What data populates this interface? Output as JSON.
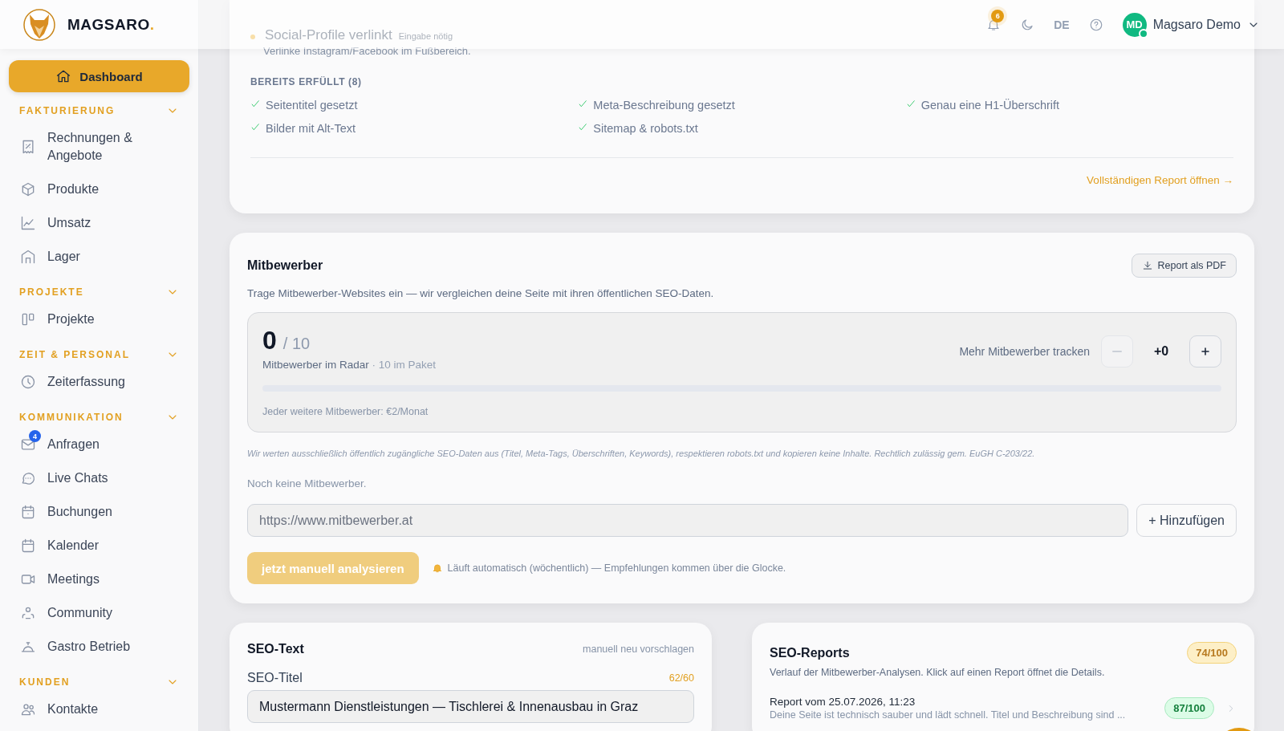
{
  "brand": {
    "name": "MAGSARO",
    "dot": "."
  },
  "header": {
    "notifications": "6",
    "language": "DE",
    "avatar": "MD",
    "user": "Magsaro Demo",
    "online": true
  },
  "sidebar": {
    "dashboard": {
      "label": "Dashboard",
      "selected": true
    },
    "sections": [
      {
        "title": "FAKTURIERUNG",
        "expanded": true,
        "items": [
          {
            "label": "Rechnungen & Angebote"
          },
          {
            "label": "Produkte"
          },
          {
            "label": "Umsatz"
          },
          {
            "label": "Lager"
          }
        ]
      },
      {
        "title": "PROJEKTE",
        "expanded": true,
        "items": [
          {
            "label": "Projekte"
          }
        ]
      },
      {
        "title": "ZEIT & PERSONAL",
        "expanded": true,
        "items": [
          {
            "label": "Zeiterfassung"
          }
        ]
      },
      {
        "title": "KOMMUNIKATION",
        "expanded": true,
        "items": [
          {
            "label": "Anfragen",
            "badge": "4"
          },
          {
            "label": "Live Chats"
          },
          {
            "label": "Buchungen"
          },
          {
            "label": "Kalender"
          },
          {
            "label": "Meetings"
          },
          {
            "label": "Community"
          },
          {
            "label": "Gastro Betrieb"
          }
        ]
      },
      {
        "title": "KUNDEN",
        "expanded": true,
        "items": [
          {
            "label": "Kontakte"
          }
        ]
      }
    ]
  },
  "checklist": {
    "pending": {
      "title": "Social-Profile verlinkt",
      "tag": "Eingabe nötig",
      "hint": "Verlinke Instagram/Facebook im Fußbereich."
    },
    "done_heading": "BEREITS ERFÜLLT (8)",
    "done": [
      "Seitentitel gesetzt",
      "Meta-Beschreibung gesetzt",
      "Genau eine H1-Überschrift",
      "Bilder mit Alt-Text",
      "Sitemap & robots.txt"
    ],
    "link": "Vollständigen Report öffnen →"
  },
  "competitors": {
    "title": "Mitbewerber",
    "pdf_button": "Report als PDF",
    "description": "Trage Mitbewerber-Websites ein — wir vergleichen deine Seite mit ihren öffentlichen SEO-Daten.",
    "count": "0",
    "total": "/ 10",
    "count_label": "Mitbewerber im Radar",
    "package": "· 10 im Paket",
    "level": 0,
    "stepper_label": "Mehr Mitbewerber tracken",
    "minus_disabled": true,
    "extra": "+0",
    "price_note": "Jeder weitere Mitbewerber: €2/Monat",
    "legal": "Wir werten ausschließlich öffentlich zugängliche SEO-Daten aus (Titel, Meta-Tags, Überschriften, Keywords), respektieren robots.txt und kopieren keine Inhalte. Rechtlich zulässig gem. EuGH C-203/22.",
    "empty": "Noch keine Mitbewerber.",
    "url_placeholder": "https://www.mitbewerber.at",
    "add_button": "+ Hinzufügen",
    "analyze_button": "jetzt manuell analysieren",
    "analyze_disabled": true,
    "auto_note": "Läuft automatisch (wöchentlich) — Empfehlungen kommen über die Glocke."
  },
  "seo_text": {
    "title": "SEO-Text",
    "action": "manuell neu vorschlagen",
    "field_label": "SEO-Titel",
    "counter": "62/60",
    "value": "Mustermann Dienstleistungen — Tischlerei & Innenausbau in Graz"
  },
  "seo_reports": {
    "title": "SEO-Reports",
    "score": "74/100",
    "description": "Verlauf der Mitbewerber-Analysen. Klick auf einen Report öffnet die Details.",
    "reports": [
      {
        "title": "Report vom 25.07.2026, 11:23",
        "summary": "Deine Seite ist technisch sauber und lädt schnell. Titel und Beschreibung sind ...",
        "score": "87/100"
      }
    ]
  }
}
